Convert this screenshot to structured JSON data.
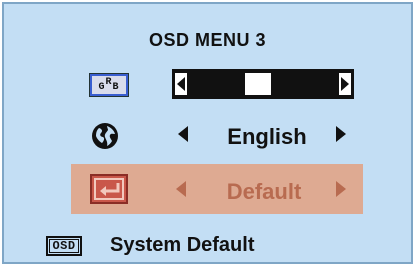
{
  "menu": {
    "title": "OSD MENU 3"
  },
  "rows": {
    "color": {
      "icon": "rgb-color-icon",
      "icon_text": {
        "g": "G",
        "r": "R",
        "b": "B"
      },
      "level": 0.55
    },
    "language": {
      "icon": "globe-icon",
      "value": "English"
    },
    "reset": {
      "icon": "reset-enter-icon",
      "value": "Default",
      "selected": true
    }
  },
  "footer": {
    "icon_text": "OSD",
    "label": "System Default"
  },
  "colors": {
    "background": "#c3def4",
    "highlight": "#deaa92",
    "highlight_text": "#b86b50",
    "text": "#111111"
  }
}
